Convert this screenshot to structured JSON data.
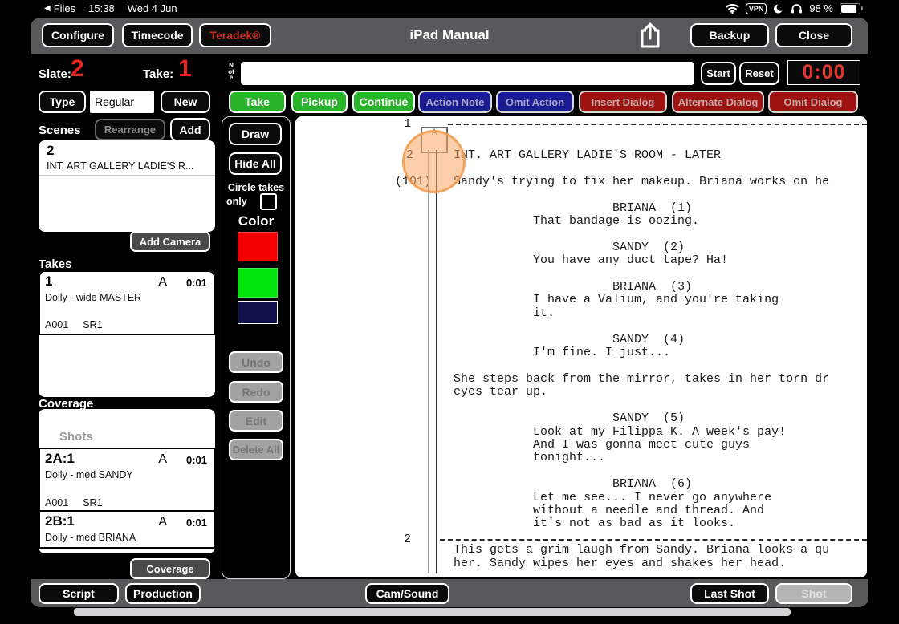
{
  "status_bar": {
    "back_icon": "◀",
    "back_app": "Files",
    "time": "15:38",
    "date": "Wed 4 Jun",
    "vpn": "VPN",
    "battery": "98 %"
  },
  "toolbar_top": {
    "configure": "Configure",
    "timecode": "Timecode",
    "teradek": "Teradek®",
    "title": "iPad Manual",
    "backup": "Backup",
    "close": "Close"
  },
  "slate_row": {
    "slate_label": "Slate:",
    "slate_value": "2",
    "take_label": "Take:",
    "take_value": "1",
    "note_label": "Note",
    "note_value": "",
    "start": "Start",
    "reset": "Reset",
    "timer": "0:00"
  },
  "type_row": {
    "type": "Type",
    "type_value": "Regular",
    "new": "New",
    "take": "Take",
    "pickup": "Pickup",
    "continue": "Continue",
    "action_note": "Action Note",
    "omit_action": "Omit Action",
    "insert_dialog": "Insert Dialog",
    "alternate_dialog": "Alternate Dialog",
    "omit_dialog": "Omit Dialog"
  },
  "scenes": {
    "label": "Scenes",
    "rearrange": "Rearrange",
    "add": "Add",
    "items": [
      {
        "number": "2",
        "slug": "INT. ART GALLERY LADIE'S R..."
      }
    ],
    "add_camera": "Add Camera"
  },
  "takes": {
    "label": "Takes",
    "items": [
      {
        "number": "1",
        "camera": "A",
        "duration": "0:01",
        "desc": "Dolly - wide MASTER",
        "roll": "A001",
        "sound": "SR1"
      }
    ]
  },
  "coverage": {
    "label": "Coverage",
    "header": "Shots",
    "items": [
      {
        "number": "2A:1",
        "camera": "A",
        "duration": "0:01",
        "desc": "Dolly - med SANDY",
        "roll": "A001",
        "sound": "SR1"
      },
      {
        "number": "2B:1",
        "camera": "A",
        "duration": "0:01",
        "desc": "Dolly - med BRIANA",
        "roll": "",
        "sound": ""
      }
    ],
    "button": "Coverage"
  },
  "draw_panel": {
    "draw": "Draw",
    "hide_all": "Hide All",
    "circle_takes_line1": "Circle takes",
    "circle_takes_line2": "only",
    "color_label": "Color",
    "swatch_red": "#f20000",
    "swatch_green": "#00e40a",
    "swatch_navy": "#10104d",
    "undo": "Undo",
    "redo": "Redo",
    "edit": "Edit",
    "delete_all": "Delete All"
  },
  "script": {
    "page1": "1",
    "page2": "2",
    "scene_number": "2",
    "scene_ref": "(101)",
    "shot_label": "A",
    "lines": [
      "INT. ART GALLERY LADIE'S ROOM - LATER",
      "",
      "Sandy's trying to fix her makeup. Briana works on he",
      "",
      "                      BRIANA  (1)",
      "           That bandage is oozing.",
      "",
      "                      SANDY  (2)",
      "           You have any duct tape? Ha!",
      "",
      "                      BRIANA  (3)",
      "           I have a Valium, and you're taking",
      "           it.",
      "",
      "                      SANDY  (4)",
      "           I'm fine. I just...",
      "",
      "She steps back from the mirror, takes in her torn dr",
      "eyes tear up.",
      "",
      "                      SANDY  (5)",
      "           Look at my Filippa K. A week's pay!",
      "           And I was gonna meet cute guys",
      "           tonight...",
      "",
      "                      BRIANA  (6)",
      "           Let me see... I never go anywhere",
      "           without a needle and thread. And",
      "           it's not as bad as it looks.",
      "",
      "This gets a grim laugh from Sandy. Briana looks a qu",
      "her. Sandy wipes her eyes and shakes her head."
    ]
  },
  "toolbar_bottom": {
    "script": "Script",
    "production": "Production",
    "cam_sound": "Cam/Sound",
    "last_shot": "Last Shot",
    "shot": "Shot"
  },
  "colors": {
    "accent_green": "#28b428",
    "accent_navy": "#1b1b94",
    "accent_dark_red": "#9e1212",
    "red_text": "#e8251c",
    "toolbar_gray": "#59595b",
    "circle_mark_fill": "#f7a764"
  }
}
